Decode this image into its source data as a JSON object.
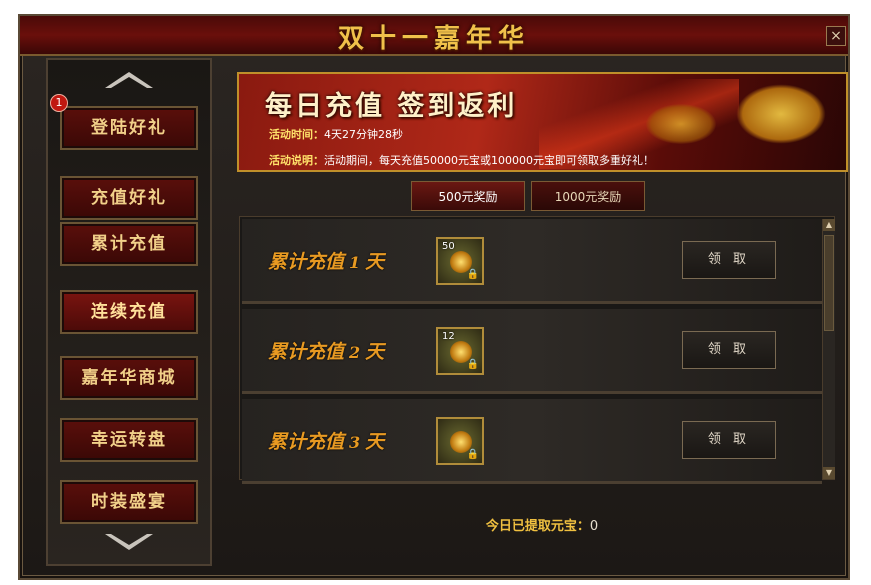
{
  "window": {
    "title": "双十一嘉年华",
    "close_label": "×"
  },
  "nav": {
    "badge": "1",
    "items": [
      {
        "label": "登陆好礼"
      },
      {
        "label": "充值好礼"
      },
      {
        "label": "累计充值"
      },
      {
        "label": "连续充值"
      },
      {
        "label": "嘉年华商城"
      },
      {
        "label": "幸运转盘"
      },
      {
        "label": "时装盛宴"
      }
    ]
  },
  "banner": {
    "title": "每日充值 签到返利",
    "time_label": "活动时间：",
    "time_value": "4天27分钟28秒",
    "desc_label": "活动说明：",
    "desc_value": "活动期间，每天充值50000元宝或100000元宝即可领取多重好礼！"
  },
  "tabs": [
    {
      "label": "500元奖励"
    },
    {
      "label": "1000元奖励"
    }
  ],
  "rows": [
    {
      "prefix": "累计充值",
      "num": "1",
      "suffix": "天",
      "item_count": "50",
      "button": "领 取"
    },
    {
      "prefix": "累计充值",
      "num": "2",
      "suffix": "天",
      "item_count": "12",
      "button": "领 取"
    },
    {
      "prefix": "累计充值",
      "num": "3",
      "suffix": "天",
      "item_count": "",
      "button": "领 取"
    }
  ],
  "footer": {
    "label": "今日已提取元宝：",
    "value": "0"
  },
  "colors": {
    "accent_gold": "#f0c14a",
    "title_red": "#6a0f0b",
    "row_label": "#e89a22"
  }
}
